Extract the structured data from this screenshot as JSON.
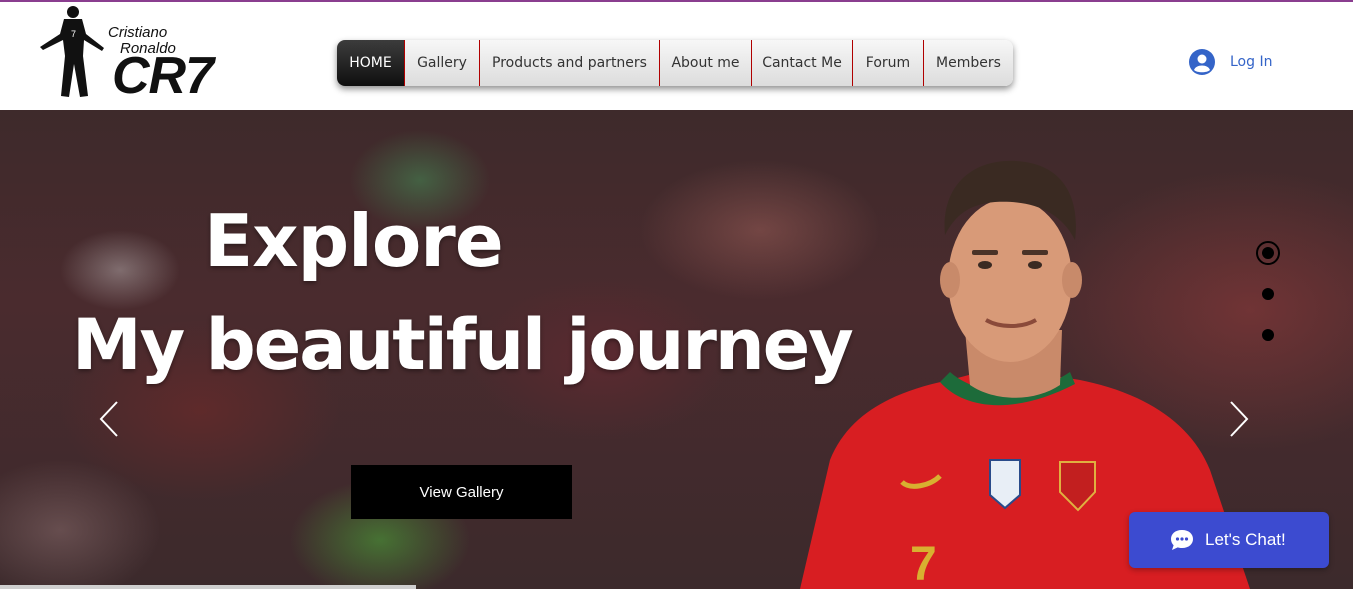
{
  "header": {
    "logo": {
      "first_name": "Cristiano",
      "last_name": "Ronaldo",
      "mark": "CR7",
      "jersey_number": "7"
    },
    "nav": {
      "items": [
        {
          "label": "HOME",
          "active": true
        },
        {
          "label": "Gallery"
        },
        {
          "label": "Products and partners"
        },
        {
          "label": "About me"
        },
        {
          "label": "Cantact Me"
        },
        {
          "label": "Forum"
        },
        {
          "label": "Members"
        }
      ]
    },
    "login": {
      "label": "Log In",
      "icon": "user-avatar-icon",
      "color": "#3464c8"
    }
  },
  "hero": {
    "line1": "Explore",
    "line2": "My beautiful journey",
    "button_label": "View Gallery",
    "prev_icon": "chevron-left-icon",
    "next_icon": "chevron-right-icon",
    "slides_total": 3,
    "active_slide": 1
  },
  "chat": {
    "label": "Let's Chat!",
    "icon": "chat-bubble-icon",
    "color": "#3c4bd0"
  },
  "colors": {
    "accent_line": "#8a3d8f",
    "nav_divider": "#b00000",
    "jersey_red": "#d81e22"
  }
}
